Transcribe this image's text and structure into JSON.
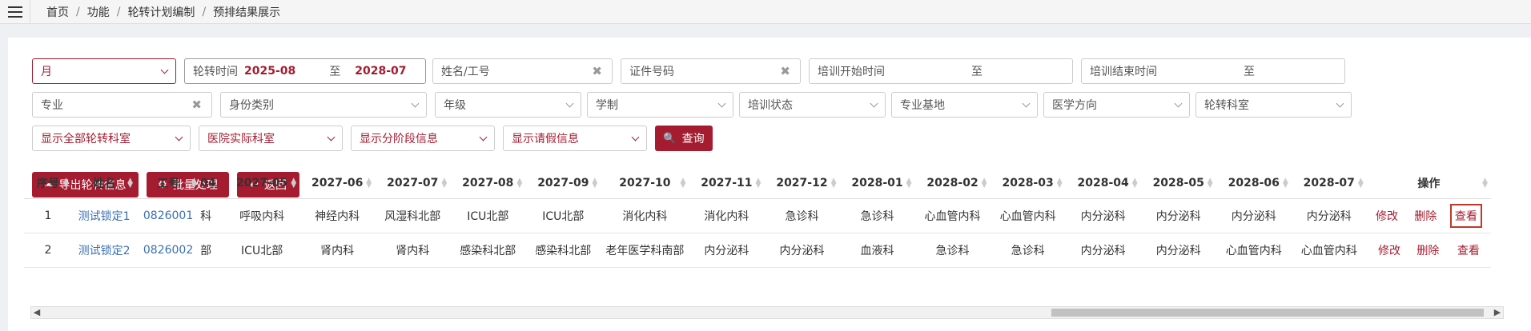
{
  "breadcrumb": [
    "首页",
    "功能",
    "轮转计划编制",
    "预排结果展示"
  ],
  "filters": {
    "period": "月",
    "rotation_label": "轮转时间",
    "rotation_start": "2025-08",
    "rotation_to": "至",
    "rotation_end": "2028-07",
    "name_placeholder": "姓名/工号",
    "cert_placeholder": "证件号码",
    "train_start_label": "培训开始时间",
    "train_start_to": "至",
    "train_end_label": "培训结束时间",
    "train_end_to": "至",
    "major": "专业",
    "identity": "身份类别",
    "grade": "年级",
    "system": "学制",
    "train_status": "培训状态",
    "major_base": "专业基地",
    "medical_direction": "医学方向",
    "rotation_dept": "轮转科室",
    "show_all_depts": "显示全部轮转科室",
    "hospital_dept": "医院实际科室",
    "show_stage": "显示分阶段信息",
    "show_leave": "显示请假信息"
  },
  "buttons": {
    "query": "查询",
    "export": "导出轮转信息",
    "batch": "批量处理",
    "back": "返回"
  },
  "table": {
    "headers": [
      "序号",
      "姓名",
      "工号",
      "04",
      "2027-05",
      "2027-06",
      "2027-07",
      "2027-08",
      "2027-09",
      "2027-10",
      "2027-11",
      "2027-12",
      "2028-01",
      "2028-02",
      "2028-03",
      "2028-04",
      "2028-05",
      "2028-06",
      "2028-07",
      "操作"
    ],
    "rows": [
      {
        "no": "1",
        "name": "测试锁定1",
        "id": "0826001",
        "c04": "科",
        "months": [
          "呼吸内科",
          "神经内科",
          "风湿科北部",
          "ICU北部",
          "ICU北部",
          "消化内科",
          "消化内科",
          "急诊科",
          "急诊科",
          "心血管内科",
          "心血管内科",
          "内分泌科",
          "内分泌科",
          "内分泌科",
          "内分泌科"
        ],
        "edit": "修改",
        "del": "删除",
        "view": "查看"
      },
      {
        "no": "2",
        "name": "测试锁定2",
        "id": "0826002",
        "c04": "部",
        "months": [
          "ICU北部",
          "肾内科",
          "肾内科",
          "感染科北部",
          "感染科北部",
          "老年医学科南部",
          "内分泌科",
          "内分泌科",
          "血液科",
          "急诊科",
          "急诊科",
          "内分泌科",
          "内分泌科",
          "心血管内科",
          "心血管内科"
        ],
        "edit": "修改",
        "del": "删除",
        "view": "查看"
      }
    ]
  },
  "colors": {
    "accent": "#a51c30",
    "link": "#3b6fb6"
  }
}
